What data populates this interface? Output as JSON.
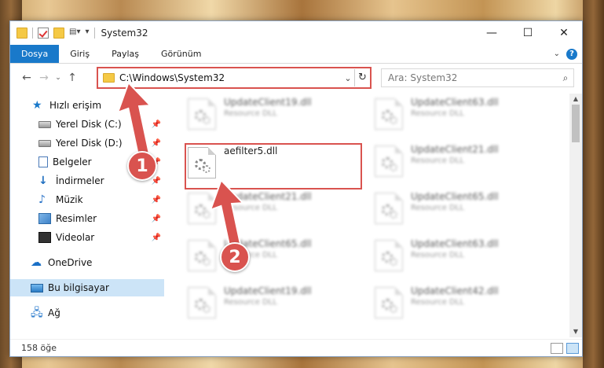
{
  "window": {
    "title": "System32"
  },
  "ribbon": {
    "tabs": [
      "Dosya",
      "Giriş",
      "Paylaş",
      "Görünüm"
    ],
    "help": "?"
  },
  "address": {
    "path": "C:\\Windows\\System32"
  },
  "search": {
    "placeholder": "Ara: System32"
  },
  "sidebar": {
    "items": [
      {
        "label": "Hızlı erişim",
        "icon": "star-icon"
      },
      {
        "label": "Yerel Disk (C:)",
        "icon": "disk-icon",
        "pinned": true
      },
      {
        "label": "Yerel Disk (D:)",
        "icon": "disk-icon",
        "pinned": true
      },
      {
        "label": "Belgeler",
        "icon": "document-icon",
        "pinned": true
      },
      {
        "label": "İndirmeler",
        "icon": "download-icon",
        "pinned": true
      },
      {
        "label": "Müzik",
        "icon": "music-icon",
        "pinned": true
      },
      {
        "label": "Resimler",
        "icon": "pictures-icon",
        "pinned": true
      },
      {
        "label": "Videolar",
        "icon": "video-icon",
        "pinned": true
      },
      {
        "label": "OneDrive",
        "icon": "cloud-icon"
      },
      {
        "label": "Bu bilgisayar",
        "icon": "computer-icon",
        "selected": true
      },
      {
        "label": "Ağ",
        "icon": "network-icon"
      }
    ]
  },
  "files": {
    "col1": [
      {
        "name": "UpdateClient19.dll",
        "type": "Resource DLL"
      },
      {
        "name": "aefilter5.dll",
        "type": ""
      },
      {
        "name": "UpdateClient21.dll",
        "type": "Resource DLL"
      },
      {
        "name": "UpdateClient65.dll",
        "type": "Resource DLL"
      },
      {
        "name": "UpdateClient19.dll",
        "type": "Resource DLL"
      }
    ],
    "col2": [
      {
        "name": "UpdateClient63.dll",
        "type": "Resource DLL"
      },
      {
        "name": "UpdateClient21.dll",
        "type": "Resource DLL"
      },
      {
        "name": "UpdateClient65.dll",
        "type": "Resource DLL"
      },
      {
        "name": "UpdateClient63.dll",
        "type": "Resource DLL"
      },
      {
        "name": "UpdateClient42.dll",
        "type": "Resource DLL"
      }
    ]
  },
  "status": {
    "count": "158 öğe"
  },
  "annotations": {
    "step1": "1",
    "step2": "2",
    "color": "#d9534f"
  }
}
